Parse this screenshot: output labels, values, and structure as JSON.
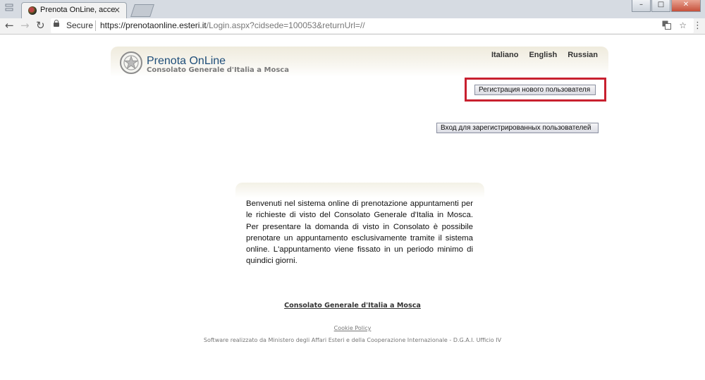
{
  "browser": {
    "tab_title": "Prenota OnLine, accesso",
    "tab_close": "×",
    "secure_label": "Secure",
    "url_host": "https://prenotaonline.esteri.it",
    "url_path": "/Login.aspx?cidsede=100053&returnUrl=//",
    "window_controls": [
      "–",
      "□",
      "✕"
    ],
    "icons": [
      "back-arrow-icon",
      "forward-arrow-icon",
      "reload-icon",
      "lock-icon",
      "translate-icon",
      "star-icon",
      "menu-dots-icon"
    ]
  },
  "site": {
    "title": "Prenota OnLine",
    "subtitle": "Consolato Generale d'Italia a Mosca"
  },
  "languages": [
    "Italiano",
    "English",
    "Russian"
  ],
  "buttons": {
    "register": "Регистрация нового пользователя",
    "login": "Вход для зарегистрированных пользователей"
  },
  "info_text": "Benvenuti nel sistema online di prenotazione appuntamenti per le richieste di visto del Consolato Generale d'Italia in Mosca. Per presentare la domanda di visto in Consolato è possibile prenotare un appuntamento esclusivamente tramite il sistema online. L'appuntamento viene fissato in un periodo minimo di quindici giorni.",
  "footer": {
    "consulate_link": "Consolato Generale d'Italia a Mosca",
    "cookie_policy": "Cookie Policy",
    "credit": "Software realizzato da Ministero degli Affari Esteri e della Cooperazione Internazionale - D.G.A.I. Ufficio IV"
  },
  "colors": {
    "highlight": "#c8202f",
    "title_blue": "#1f4e79"
  }
}
